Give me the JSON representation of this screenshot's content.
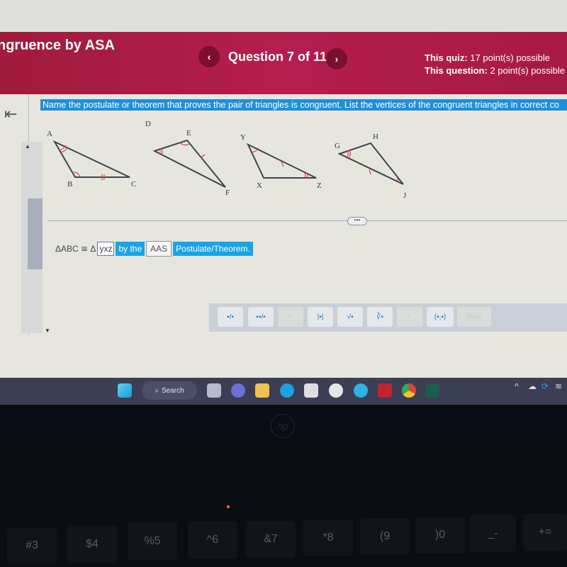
{
  "header": {
    "course_title": "ngruence by ASA",
    "prev_icon": "chevron-left-icon",
    "prev_label": "‹",
    "question_label": "Question 7 of 11",
    "next_icon": "chevron-right-icon",
    "next_label": "›",
    "quiz_points_label": "This quiz:",
    "quiz_points_value": "17 point(s) possible",
    "question_points_label": "This question:",
    "question_points_value": "2 point(s) possible"
  },
  "sidebar": {
    "collapse_icon": "collapse-left-icon",
    "collapse_glyph": "⇤"
  },
  "question": {
    "prompt": "Name the postulate or theorem that proves the pair of triangles is congruent. List the vertices of the congruent triangles in correct co",
    "figures": [
      {
        "name": "ABC",
        "labels": [
          "A",
          "B",
          "C"
        ]
      },
      {
        "name": "DEF",
        "labels": [
          "D",
          "E",
          "F"
        ]
      },
      {
        "name": "XYZ",
        "labels": [
          "Y",
          "X",
          "Z"
        ]
      },
      {
        "name": "GHJ",
        "labels": [
          "G",
          "H",
          "J"
        ]
      }
    ],
    "expand_label": "•••"
  },
  "answer": {
    "prefix": "ΔABC ≅ Δ",
    "triangle_value": "yxz",
    "by_the": "by the",
    "postulate_value": "AAS",
    "suffix": "Postulate/Theorem."
  },
  "math_toolbar": {
    "tools": [
      {
        "name": "fraction",
        "glyph": "▪/▪"
      },
      {
        "name": "mixed-number",
        "glyph": "▪▪/▪"
      },
      {
        "name": "exponent",
        "glyph": "▪ᐧ"
      },
      {
        "name": "absolute-value",
        "glyph": "|▪|"
      },
      {
        "name": "square-root",
        "glyph": "√▪"
      },
      {
        "name": "nth-root",
        "glyph": "∛▪"
      },
      {
        "name": "decimal",
        "glyph": "▪."
      },
      {
        "name": "ordered-pair",
        "glyph": "(▪,▪)"
      },
      {
        "name": "more",
        "glyph": "More"
      }
    ]
  },
  "taskbar": {
    "search_label": "Search",
    "apps": [
      "start",
      "task-view",
      "teams-chat",
      "file-explorer",
      "edge",
      "microsoft-store",
      "app-circle",
      "get-help",
      "mcafee",
      "chrome",
      "app-grid"
    ],
    "tray": {
      "chevron": "^",
      "icons": [
        "onedrive-icon",
        "sync-icon",
        "wifi-icon"
      ]
    }
  },
  "laptop": {
    "brand": "hp",
    "keys": [
      "#3",
      "$4",
      "%5",
      "^6",
      "&7",
      "*8",
      "(9",
      ")0",
      "_-",
      "+="
    ]
  }
}
